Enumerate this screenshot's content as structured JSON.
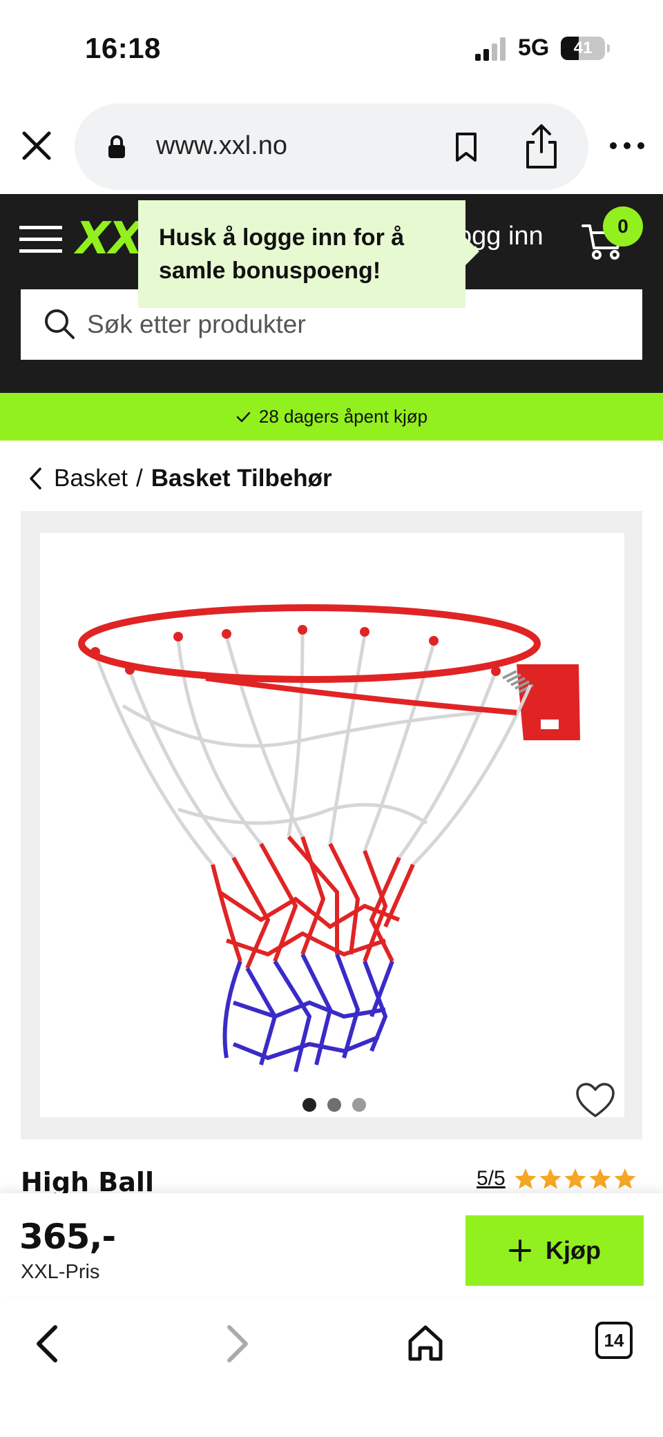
{
  "status_bar": {
    "time": "16:18",
    "network": "5G",
    "battery": "41",
    "battery_level": 0.41
  },
  "browser": {
    "url": "www.xxl.no",
    "icons": [
      "close-icon",
      "lock-icon",
      "bookmark-icon",
      "share-icon",
      "more-icon"
    ]
  },
  "header": {
    "logo": "XXL",
    "login_label": "ogg inn",
    "cart_count": "0",
    "search_placeholder": "Søk etter produkter"
  },
  "tooltip": {
    "text": "Husk å logge inn for å samle bonuspoeng!"
  },
  "promo": {
    "text": "28 dagers åpent kjøp"
  },
  "breadcrumb": {
    "parent": "Basket",
    "separator": "/",
    "current": "Basket Tilbehør"
  },
  "gallery": {
    "image_count": 3,
    "active_index": 0
  },
  "product": {
    "title": "High Ball",
    "rating": "5/5",
    "stars": 5
  },
  "buy_bar": {
    "price": "365,-",
    "price_label": "XXL-Pris",
    "buy_label": "Kjøp"
  },
  "toolbar": {
    "tab_count": "14"
  },
  "colors": {
    "brand_green": "#92f01e",
    "header_dark": "#1c1c1c",
    "tooltip_bg": "#e6f9d1",
    "star": "#f5a623"
  }
}
